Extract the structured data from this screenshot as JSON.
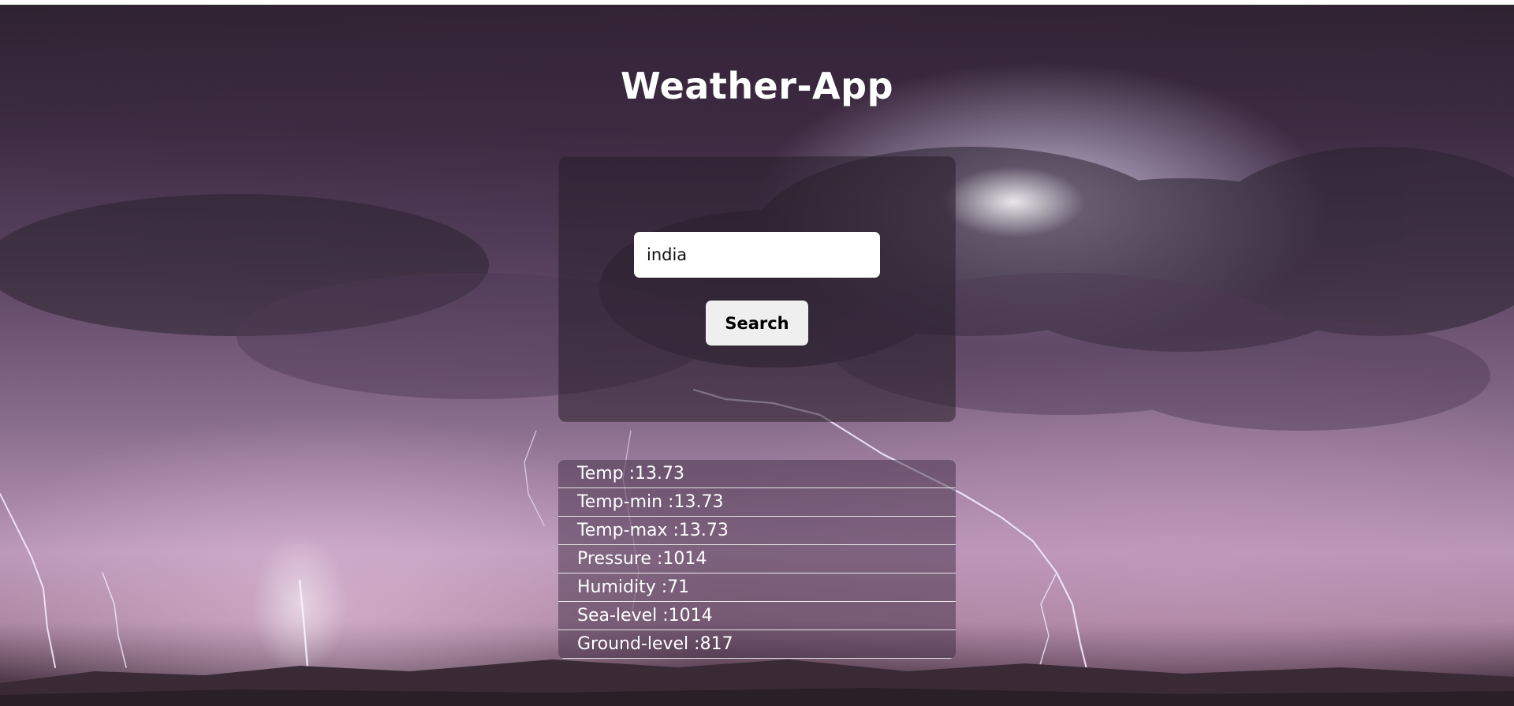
{
  "app": {
    "title": "Weather-App"
  },
  "search": {
    "value": "india",
    "button_label": "Search"
  },
  "results": [
    {
      "label": "Temp",
      "value": "13.73"
    },
    {
      "label": "Temp-min",
      "value": "13.73"
    },
    {
      "label": "Temp-max",
      "value": "13.73"
    },
    {
      "label": "Pressure",
      "value": "1014"
    },
    {
      "label": "Humidity",
      "value": "71"
    },
    {
      "label": "Sea-level",
      "value": "1014"
    },
    {
      "label": "Ground-level",
      "value": "817"
    }
  ],
  "colors": {
    "title_text": "#ffffff",
    "card_bg": "rgba(40,30,42,0.55)",
    "button_bg": "#efefef",
    "row_divider": "#ffffff"
  }
}
